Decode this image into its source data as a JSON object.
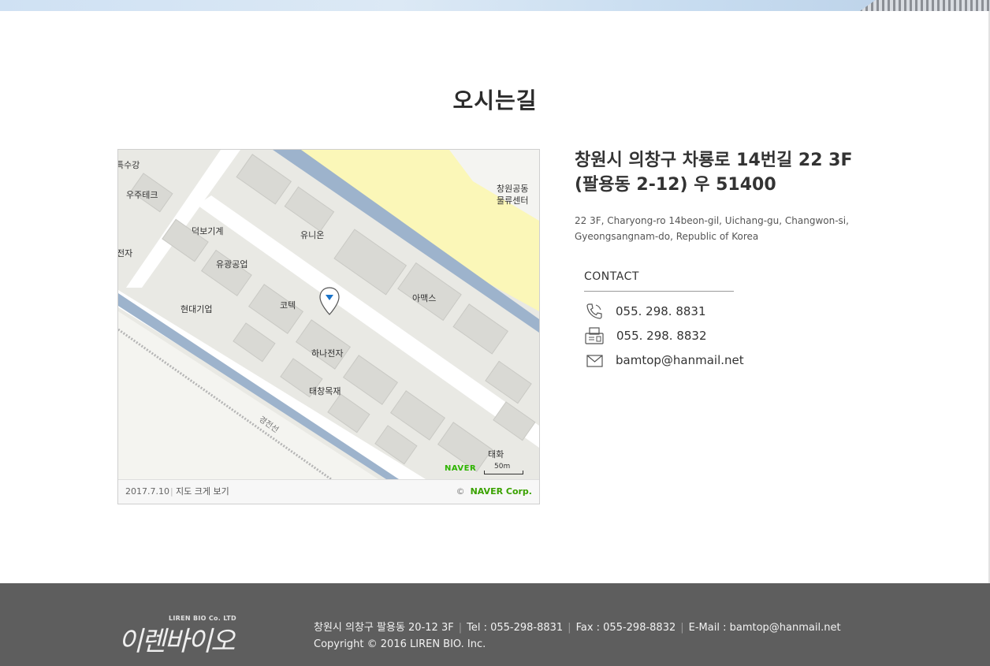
{
  "page": {
    "title": "오시는길"
  },
  "map": {
    "date": "2017.7.10",
    "big_map_link": "지도 크게 보기",
    "copyright_symbol": "©",
    "copyright_owner": "NAVER Corp.",
    "logo": "NAVER",
    "scale": "50m",
    "places": [
      {
        "name": "특수강"
      },
      {
        "name": "우주테크"
      },
      {
        "name": "덕보기계"
      },
      {
        "name": "유니온"
      },
      {
        "name": "전자"
      },
      {
        "name": "유광공업"
      },
      {
        "name": "현대기업"
      },
      {
        "name": "코텍"
      },
      {
        "name": "아맥스"
      },
      {
        "name": "하나전자"
      },
      {
        "name": "태창목재"
      },
      {
        "name": "태화"
      },
      {
        "name": "창원공동"
      },
      {
        "name": "물류센터"
      },
      {
        "name": "경전선"
      }
    ]
  },
  "address": {
    "korean_line1": "창원시 의창구 차룡로 14번길 22 3F",
    "korean_line2": "(팔용동 2-12) 우 51400",
    "english_line1": "22 3F, Charyong-ro 14beon-gil, Uichang-gu, Changwon-si,",
    "english_line2": "Gyeongsangnam-do, Republic of Korea"
  },
  "contact": {
    "title": "CONTACT",
    "items": [
      {
        "icon": "phone-icon",
        "value": "055. 298. 8831"
      },
      {
        "icon": "fax-icon",
        "value": "055. 298. 8832"
      },
      {
        "icon": "mail-icon",
        "value": "bamtop@hanmail.net"
      }
    ]
  },
  "footer": {
    "logo_en": "LIREN BIO Co. LTD",
    "logo_ko": "이렌바이오",
    "address": "창원시 의창구 팔용동 20-12 3F",
    "tel": "Tel : 055-298-8831",
    "fax": "Fax : 055-298-8832",
    "email": "E-Mail : bamtop@hanmail.net",
    "copyright": "Copyright © 2016 LIREN BIO. Inc."
  },
  "colors": {
    "footer_bg": "#5e5e5e",
    "naver_green": "#2db400",
    "pin_blue": "#1a73c8",
    "river": "#9db3cc",
    "park": "#fbf7b8"
  }
}
